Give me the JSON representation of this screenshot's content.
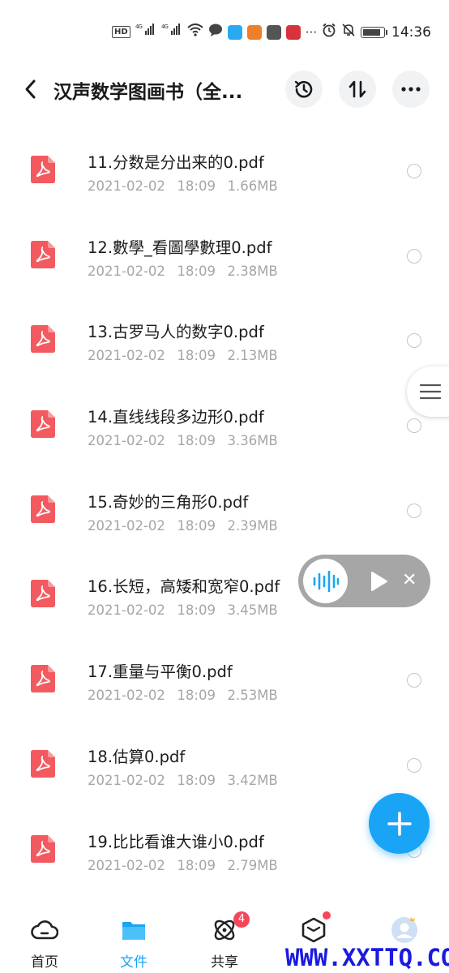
{
  "status_bar": {
    "time": "14:36",
    "network_label": "4G",
    "hd_label": "HD",
    "battery_level": 0.9
  },
  "header": {
    "title": "汉声数学图画书（全..."
  },
  "files": [
    {
      "name": "11.分数是分出来的0.pdf",
      "date": "2021-02-02",
      "time": "18:09",
      "size": "1.66MB"
    },
    {
      "name": "12.數學_看圖學數理0.pdf",
      "date": "2021-02-02",
      "time": "18:09",
      "size": "2.38MB"
    },
    {
      "name": "13.古罗马人的数字0.pdf",
      "date": "2021-02-02",
      "time": "18:09",
      "size": "2.13MB"
    },
    {
      "name": "14.直线线段多边形0.pdf",
      "date": "2021-02-02",
      "time": "18:09",
      "size": "3.36MB"
    },
    {
      "name": "15.奇妙的三角形0.pdf",
      "date": "2021-02-02",
      "time": "18:09",
      "size": "2.39MB"
    },
    {
      "name": "16.长短，高矮和宽窄0.pdf",
      "date": "2021-02-02",
      "time": "18:09",
      "size": "3.45MB"
    },
    {
      "name": "17.重量与平衡0.pdf",
      "date": "2021-02-02",
      "time": "18:09",
      "size": "2.53MB"
    },
    {
      "name": "18.估算0.pdf",
      "date": "2021-02-02",
      "time": "18:09",
      "size": "3.42MB"
    },
    {
      "name": "19.比比看谁大谁小0.pdf",
      "date": "2021-02-02",
      "time": "18:09",
      "size": "2.79MB"
    }
  ],
  "audio_player": {
    "close_glyph": "✕"
  },
  "bottom_nav": {
    "items": [
      {
        "label": "首页",
        "active": false
      },
      {
        "label": "文件",
        "active": true
      },
      {
        "label": "共享",
        "active": false,
        "badge": "4"
      },
      {
        "label": "",
        "active": false,
        "dot": true
      },
      {
        "label": "",
        "active": false
      }
    ]
  },
  "watermark": "WWW.XXTTQ.COM",
  "colors": {
    "accent": "#1aa4f5",
    "pdf_red": "#f25a60",
    "badge_red": "#f5465a",
    "meta_gray": "#a6a6a6"
  },
  "icons": {
    "back": "chevron-left-icon",
    "history": "history-icon",
    "sort": "sort-icon",
    "more": "more-icon",
    "pdf": "pdf-icon",
    "add": "plus-icon"
  }
}
